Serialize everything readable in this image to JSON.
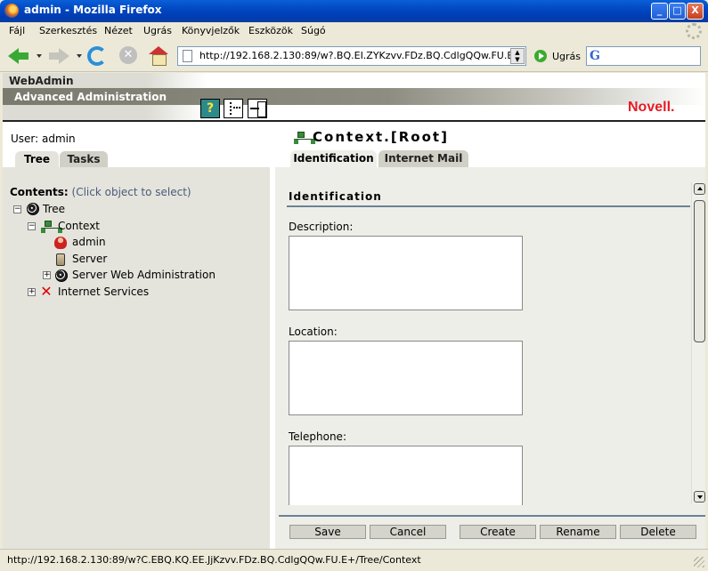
{
  "window": {
    "title": "admin - Mozilla Firefox",
    "buttons": [
      "_",
      "□",
      "X"
    ]
  },
  "menubar": {
    "items": [
      "Fájl",
      "Szerkesztés",
      "Nézet",
      "Ugrás",
      "Könyvjelzők",
      "Eszközök",
      "Súgó"
    ]
  },
  "toolbar": {
    "url": "http://192.168.2.130:89/w?.BQ.EI.ZYKzvv.FDz.BQ.CdlgQQw.FU.E",
    "go_label": "Ugrás",
    "search_value": "",
    "icons": [
      "back-arrow-icon",
      "forward-arrow-icon",
      "reload-icon",
      "stop-icon",
      "home-icon",
      "page-icon",
      "go-icon",
      "google-icon",
      "throbber-icon"
    ]
  },
  "webadmin": {
    "title": "WebAdmin",
    "subtitle": "Advanced Administration",
    "brand": "Novell.",
    "brand_color": "#e41b23",
    "tool_icons": [
      "help-icon",
      "tree-view-icon",
      "exit-icon"
    ]
  },
  "left": {
    "user_label": "User:  admin",
    "tabs": [
      "Tree",
      "Tasks"
    ],
    "contents_label": "Contents:",
    "contents_hint": "(Click object to select)",
    "tree": [
      {
        "label": "Tree",
        "expander": "−",
        "icon": "globe-icon"
      },
      {
        "label": "Context",
        "expander": "−",
        "icon": "context-icon"
      },
      {
        "label": "admin",
        "expander": "",
        "icon": "user-icon"
      },
      {
        "label": "Server",
        "expander": "",
        "icon": "server-icon"
      },
      {
        "label": "Server Web Administration",
        "expander": "+",
        "icon": "globe-icon"
      },
      {
        "label": "Internet Services",
        "expander": "+",
        "icon": "x-icon"
      }
    ]
  },
  "right": {
    "object_title": "Context.[Root]",
    "tabs": [
      "Identification",
      "Internet Mail"
    ],
    "section_title": "Identification",
    "fields": [
      {
        "label": "Description:",
        "value": ""
      },
      {
        "label": "Location:",
        "value": ""
      },
      {
        "label": "Telephone:",
        "value": ""
      }
    ],
    "buttons": [
      "Save",
      "Cancel",
      "Create",
      "Rename",
      "Delete"
    ]
  },
  "statusbar": {
    "text": "http://192.168.2.130:89/w?C.EBQ.KQ.EE.JjKzvv.FDz.BQ.CdlgQQw.FU.E+/Tree/Context"
  },
  "colors": {
    "titlebar": "#0046c0",
    "panel_bg": "#e4e4dc",
    "form_bg": "#eeeee8",
    "accent_rule": "#6a8296"
  }
}
